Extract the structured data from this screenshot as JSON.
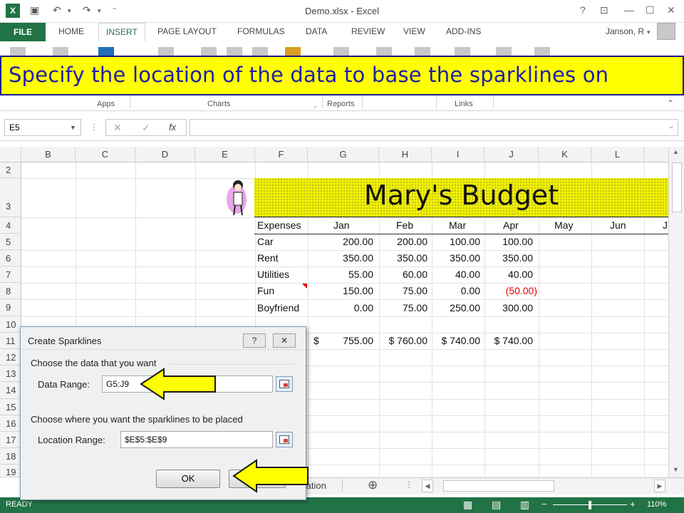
{
  "window": {
    "title": "Demo.xlsx - Excel",
    "user": "Janson, R",
    "help": "?"
  },
  "ribbon": {
    "tabs": [
      "FILE",
      "HOME",
      "INSERT",
      "PAGE LAYOUT",
      "FORMULAS",
      "DATA",
      "REVIEW",
      "VIEW",
      "ADD-INS"
    ],
    "groups": [
      "Apps",
      "Charts",
      "Reports",
      "Links"
    ]
  },
  "banner": {
    "text": "Specify the location of the data to base the sparklines on"
  },
  "formula_bar": {
    "name_box": "E5",
    "fx": "fx",
    "formula": ""
  },
  "sheet": {
    "columns": [
      "B",
      "C",
      "D",
      "E",
      "F",
      "G",
      "H",
      "I",
      "J",
      "K",
      "L"
    ],
    "rows": [
      "2",
      "3",
      "4",
      "5",
      "6",
      "7",
      "8",
      "9",
      "10",
      "11",
      "12",
      "13",
      "14",
      "15",
      "16",
      "17",
      "18",
      "19"
    ],
    "budget_title": "Mary's Budget",
    "header": [
      "Expenses",
      "Jan",
      "Feb",
      "Mar",
      "Apr",
      "May",
      "Jun",
      "J"
    ],
    "expenses": [
      {
        "name": "Car",
        "jan": "200.00",
        "feb": "200.00",
        "mar": "100.00",
        "apr": "100.00"
      },
      {
        "name": "Rent",
        "jan": "350.00",
        "feb": "350.00",
        "mar": "350.00",
        "apr": "350.00"
      },
      {
        "name": "Utilities",
        "jan": "55.00",
        "feb": "60.00",
        "mar": "40.00",
        "apr": "40.00"
      },
      {
        "name": "Fun",
        "jan": "150.00",
        "feb": "75.00",
        "mar": "0.00",
        "apr": "(50.00)"
      },
      {
        "name": "Boyfriend",
        "jan": "0.00",
        "feb": "75.00",
        "mar": "250.00",
        "apr": "300.00"
      }
    ],
    "totals": {
      "currency": "$",
      "jan": "755.00",
      "feb": "$ 760.00",
      "mar": "$ 740.00",
      "apr": "$ 740.00"
    },
    "negative_color": "#e00000"
  },
  "dialog": {
    "title": "Create Sparklines",
    "help_btn": "?",
    "close_btn": "✕",
    "section1": "Choose the data that you want",
    "data_range_label": "Data Range:",
    "data_range_value": "G5:J9",
    "section2": "Choose where you want the sparklines to be placed",
    "location_label": "Location Range:",
    "location_value": "$E$5:$E$9",
    "ok": "OK"
  },
  "sheet_tabs": {
    "partial_tab": "tation",
    "add": "⊕"
  },
  "status": {
    "mode": "READY",
    "zoom": "110%"
  }
}
